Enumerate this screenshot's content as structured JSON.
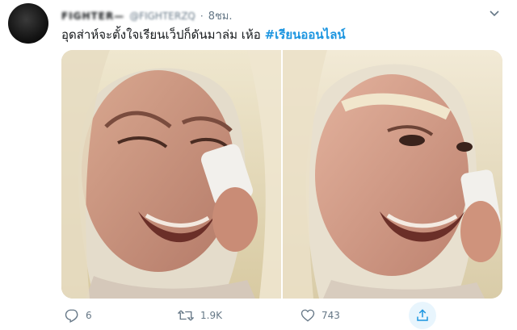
{
  "tweet": {
    "author_name": "FIGHTER—",
    "author_handle": "@FIGHTERZQ",
    "dot": "·",
    "time": "8ชม.",
    "text": "อุดส่าห์จะตั้งใจเรียนเว็ปก็ดันมาล่ม เห้อ ",
    "hashtag": "#เรียนออนไลน์"
  },
  "actions": {
    "reply_count": "6",
    "retweet_count": "1.9K",
    "like_count": "743"
  },
  "icons": {
    "caret": "chevron-down-icon",
    "reply": "reply-icon",
    "retweet": "retweet-icon",
    "like": "heart-icon",
    "share": "share-icon"
  },
  "colors": {
    "accent": "#1b95e0",
    "secondary_text": "#657786",
    "share_highlight": "#e8f5fd"
  }
}
